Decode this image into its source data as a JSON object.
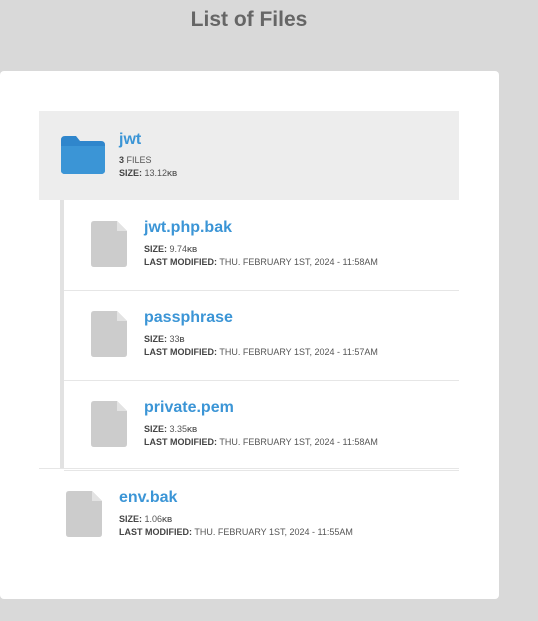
{
  "header": {
    "title": "List of Files"
  },
  "folder": {
    "name": "jwt",
    "count": "3",
    "count_label": "FILES",
    "size_label": "SIZE:",
    "size_value": "13.12",
    "size_unit": "KB",
    "icon": "folder-icon",
    "color": "#3b95d6"
  },
  "files": [
    {
      "name": "jwt.php.bak",
      "size_label": "SIZE:",
      "size_value": "9.74",
      "size_unit": "KB",
      "modified_label": "LAST MODIFIED:",
      "modified": "THU. FEBRUARY 1ST, 2024 - 11:58AM"
    },
    {
      "name": "passphrase",
      "size_label": "SIZE:",
      "size_value": "33",
      "size_unit": "B",
      "modified_label": "LAST MODIFIED:",
      "modified": "THU. FEBRUARY 1ST, 2024 - 11:57AM"
    },
    {
      "name": "private.pem",
      "size_label": "SIZE:",
      "size_value": "3.35",
      "size_unit": "KB",
      "modified_label": "LAST MODIFIED:",
      "modified": "THU. FEBRUARY 1ST, 2024 - 11:58AM"
    },
    {
      "name": "env.bak",
      "size_label": "SIZE:",
      "size_value": "1.06",
      "size_unit": "KB",
      "modified_label": "LAST MODIFIED:",
      "modified": "THU. FEBRUARY 1ST, 2024 - 11:55AM"
    }
  ],
  "icons": {
    "file": "file-icon",
    "folder": "folder-icon"
  },
  "colors": {
    "link": "#3b95d6",
    "icon_gray": "#cccccc",
    "background": "#d9d9d9"
  }
}
